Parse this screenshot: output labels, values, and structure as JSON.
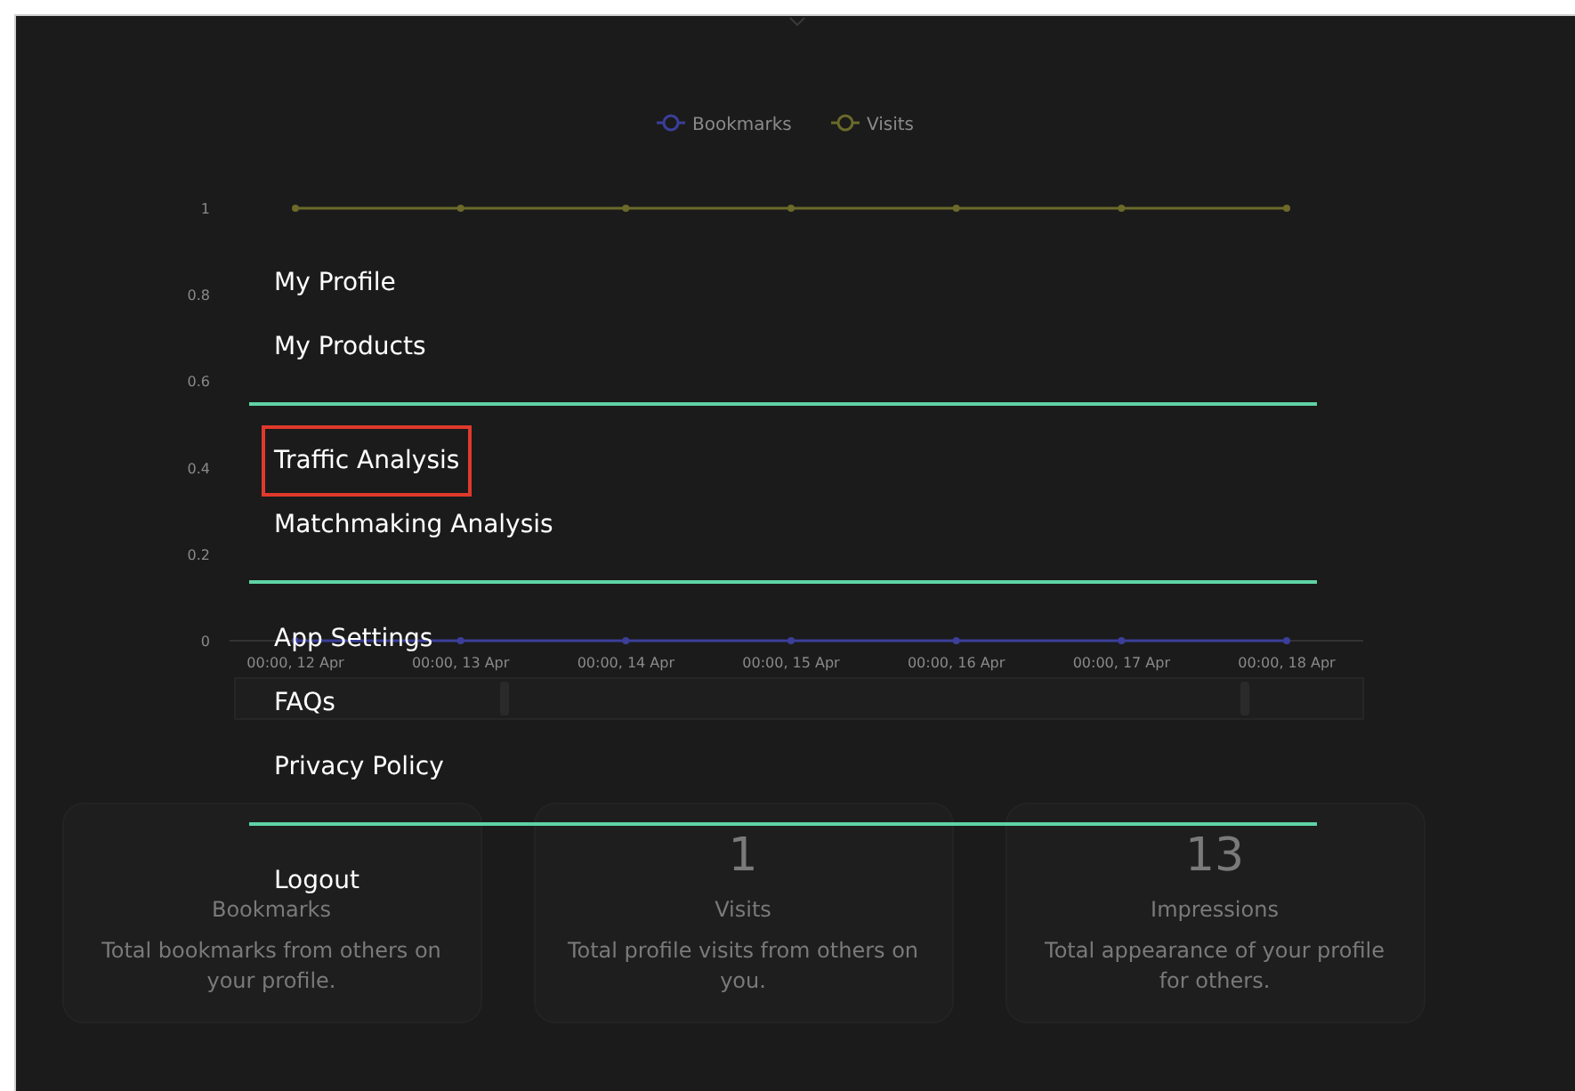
{
  "chart": {
    "chart_data": {
      "type": "line",
      "categories": [
        "00:00, 12 Apr",
        "00:00, 13 Apr",
        "00:00, 14 Apr",
        "00:00, 15 Apr",
        "00:00, 16 Apr",
        "00:00, 17 Apr",
        "00:00, 18 Apr"
      ],
      "legend": "top",
      "series": [
        {
          "name": "Bookmarks",
          "color": "#3b3f9a",
          "marker": "circle",
          "values": [
            0,
            0,
            0,
            0,
            0,
            0,
            0
          ]
        },
        {
          "name": "Visits",
          "color": "#6b6a2a",
          "marker": "circle",
          "values": [
            1,
            1,
            1,
            1,
            1,
            1,
            1
          ]
        }
      ],
      "ylim": [
        0,
        1
      ],
      "yticks": [
        0,
        0.2,
        0.4,
        0.6,
        0.8,
        1
      ]
    }
  },
  "cards": [
    {
      "title": "Bookmarks",
      "description": "Total bookmarks from others on your profile."
    },
    {
      "value": "1",
      "title": "Visits",
      "description": "Total profile visits from others on you."
    },
    {
      "value": "13",
      "title": "Impressions",
      "description": "Total appearance of your profile for others."
    }
  ],
  "menu": {
    "groups": [
      [
        {
          "label": "My Profile",
          "selected": false
        },
        {
          "label": "My Products",
          "selected": false
        }
      ],
      [
        {
          "label": "Traffic Analysis",
          "selected": true
        },
        {
          "label": "Matchmaking Analysis",
          "selected": false
        }
      ],
      [
        {
          "label": "App Settings",
          "selected": false
        },
        {
          "label": "FAQs",
          "selected": false
        },
        {
          "label": "Privacy Policy",
          "selected": false
        }
      ],
      [
        {
          "label": "Logout",
          "selected": false
        }
      ]
    ]
  }
}
